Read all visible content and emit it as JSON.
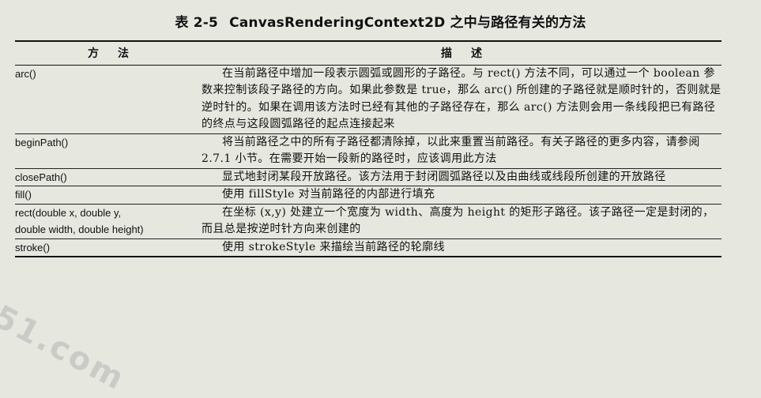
{
  "caption": {
    "number": "表 2-5",
    "title": "CanvasRenderingContext2D 之中与路径有关的方法"
  },
  "table": {
    "headers": [
      "方法",
      "描述"
    ],
    "rows": [
      {
        "method": [
          "arc()"
        ],
        "description": "在当前路径中增加一段表示圆弧或圆形的子路径。与 rect() 方法不同，可以通过一个 boolean 参数来控制该段子路径的方向。如果此参数是 true，那么 arc() 所创建的子路径就是顺时针的，否则就是逆时针的。如果在调用该方法时已经有其他的子路径存在，那么 arc() 方法则会用一条线段把已有路径的终点与这段圆弧路径的起点连接起来"
      },
      {
        "method": [
          "beginPath()"
        ],
        "description": "将当前路径之中的所有子路径都清除掉，以此来重置当前路径。有关子路径的更多内容，请参阅 2.7.1 小节。在需要开始一段新的路径时，应该调用此方法"
      },
      {
        "method": [
          "closePath()"
        ],
        "description": "显式地封闭某段开放路径。该方法用于封闭圆弧路径以及由曲线或线段所创建的开放路径"
      },
      {
        "method": [
          "fill()"
        ],
        "description": "使用 fillStyle 对当前路径的内部进行填充"
      },
      {
        "method": [
          "rect(double x, double y,",
          "double width, double height)"
        ],
        "description": "在坐标 (x,y) 处建立一个宽度为 width、高度为 height 的矩形子路径。该子路径一定是封闭的，而且总是按逆时针方向来创建的"
      },
      {
        "method": [
          "stroke()"
        ],
        "description": "使用 strokeStyle 来描绘当前路径的轮廓线"
      }
    ]
  },
  "watermark": "51.com"
}
